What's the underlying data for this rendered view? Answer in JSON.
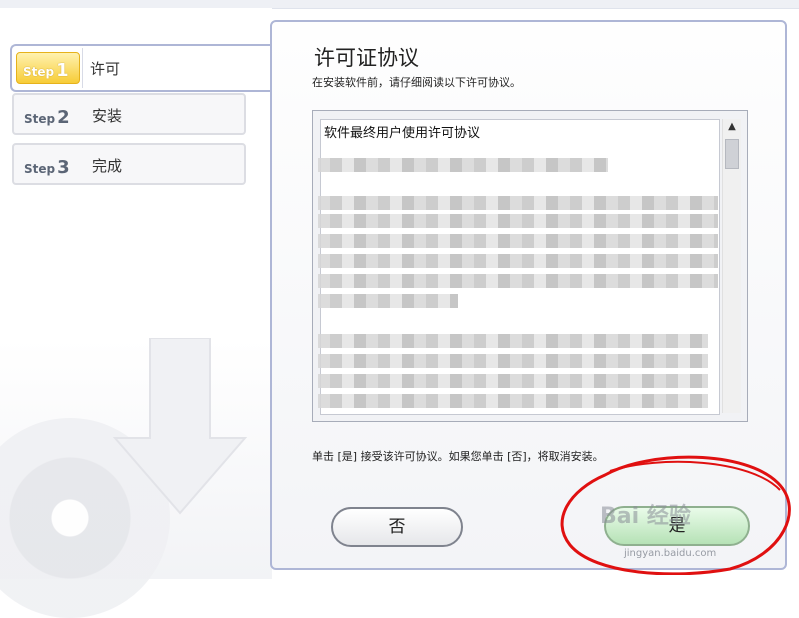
{
  "steps": [
    {
      "tag": "Step",
      "num": "1",
      "label": "许可",
      "active": true
    },
    {
      "tag": "Step",
      "num": "2",
      "label": "安装",
      "active": false
    },
    {
      "tag": "Step",
      "num": "3",
      "label": "完成",
      "active": false
    }
  ],
  "panel": {
    "title": "许可证协议",
    "subtitle": "在安装软件前，请仔细阅读以下许可协议。",
    "license_first_line": "软件最终用户使用许可协议",
    "notice": "单击 [是] 接受该许可协议。如果您单击 [否]，将取消安装。"
  },
  "buttons": {
    "no_label": "否",
    "yes_label": "是"
  },
  "watermark": {
    "brand": "Bai 经验",
    "url": "jingyan.baidu.com"
  },
  "colors": {
    "panel_border": "#aeb6d6",
    "step_active": "#f7cc37",
    "annotation_red": "#e01010"
  },
  "icons": [
    "disc-icon",
    "download-arrow-icon",
    "scroll-up-icon"
  ]
}
